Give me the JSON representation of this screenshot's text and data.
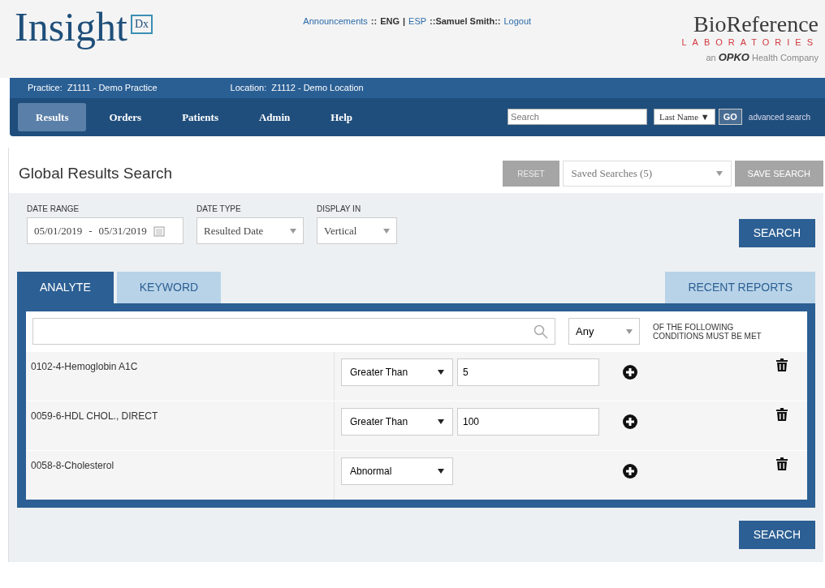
{
  "logo": {
    "name": "Insight",
    "badge": "Dx"
  },
  "top_links": [
    {
      "text": "Announcements",
      "kind": "link"
    },
    {
      "text": "::",
      "kind": "text"
    },
    {
      "text": "ENG",
      "kind": "text"
    },
    {
      "text": "|",
      "kind": "text"
    },
    {
      "text": "ESP",
      "kind": "link"
    },
    {
      "text": "::Samuel Smith::",
      "kind": "text"
    },
    {
      "text": "Logout",
      "kind": "link"
    }
  ],
  "brand": {
    "name": "BioReference",
    "sub": "LABORATORIES",
    "pre": "an",
    "company": "OPKO",
    "post": "Health Company"
  },
  "context": {
    "practice_label": "Practice:",
    "practice": "Z1111 - Demo Practice",
    "location_label": "Location:",
    "location": "Z1112 - Demo Location"
  },
  "nav": [
    {
      "label": "Results",
      "selected": true
    },
    {
      "label": "Orders",
      "selected": false
    },
    {
      "label": "Patients",
      "selected": false
    },
    {
      "label": "Admin",
      "selected": false
    },
    {
      "label": "Help",
      "selected": false
    }
  ],
  "nav_search": {
    "placeholder": "Search",
    "field": "Last Name ▼",
    "go": "GO",
    "advanced": "advanced search"
  },
  "page_title": "Global Results Search",
  "toolbar": {
    "reset": "RESET",
    "saved": "Saved Searches (5)",
    "save": "SAVE SEARCH"
  },
  "filters": [
    {
      "label": "DATE RANGE",
      "kind": "daterange",
      "from": "05/01/2019",
      "sep": "-",
      "to": "05/31/2019"
    },
    {
      "label": "DATE TYPE",
      "kind": "select",
      "value": "Resulted Date"
    },
    {
      "label": "DISPLAY IN",
      "kind": "select",
      "value": "Vertical"
    }
  ],
  "search_button": "SEARCH",
  "tabs": [
    {
      "label": "ANALYTE",
      "selected": true
    },
    {
      "label": "KEYWORD",
      "selected": false
    },
    {
      "label": "RECENT REPORTS",
      "selected": false
    }
  ],
  "match": {
    "value": "Any",
    "text": "OF THE FOLLOWING CONDITIONS MUST BE MET"
  },
  "conditions": [
    {
      "analyte": "0102-4-Hemoglobin A1C",
      "operator": "Greater Than",
      "kind": "value",
      "value": "5"
    },
    {
      "analyte": "0059-6-HDL CHOL., DIRECT",
      "operator": "Greater Than",
      "kind": "value",
      "value": "100"
    },
    {
      "analyte": "0058-8-Cholesterol",
      "operator": "Abnormal",
      "kind": "plain"
    }
  ],
  "bottom_button": "SEARCH"
}
